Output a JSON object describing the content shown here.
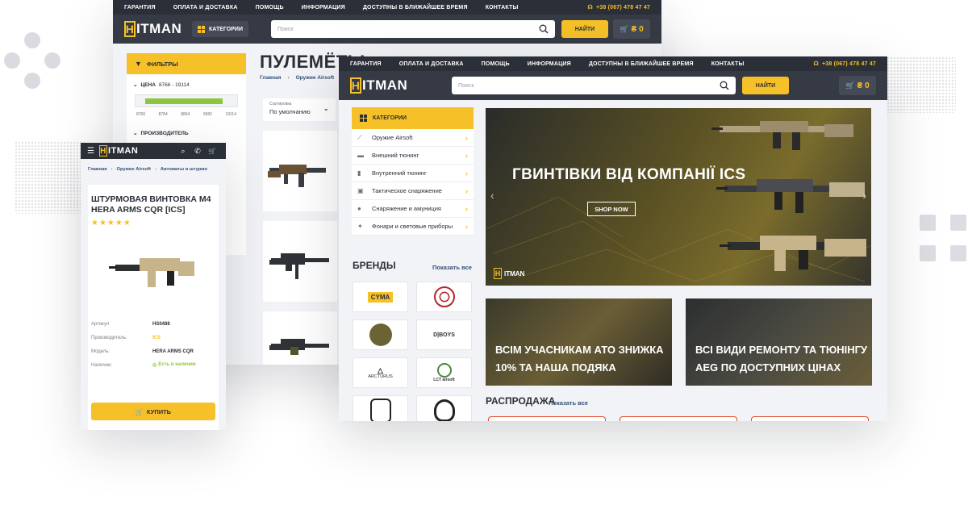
{
  "colors": {
    "accent": "#f5c028",
    "dark": "#2b2f38",
    "green": "#8cc63f",
    "sale": "#e04b2a"
  },
  "back": {
    "top_links": [
      "Гарантия",
      "Оплата и доставка",
      "Помощь",
      "Информация",
      "Доступны в ближайшее время",
      "Контакты"
    ],
    "phone": "+38 (067) 478 47 47",
    "logo_letter": "H",
    "logo_rest": "ITMAN",
    "categories_label": "Категории",
    "search_placeholder": "Поиск",
    "search_button": "Найти",
    "cart_symbol": "₴",
    "cart_count": "0",
    "filters_label": "Фильтры",
    "price_label": "Цена",
    "price_range": "8766 - 19114",
    "price_ticks": [
      "8766",
      "8784",
      "8864",
      "9582",
      "19114"
    ],
    "manufacturer_label": "Производитель",
    "page_title": "Пулемёты",
    "breadcrumb": [
      "Главная",
      "Оружие Airsoft"
    ],
    "sort_label": "Сортировка",
    "sort_value": "По умолчанию"
  },
  "front": {
    "top_links": [
      "Гарантия",
      "Оплата и доставка",
      "Помощь",
      "Информация",
      "Доступны в ближайшее время",
      "Контакты"
    ],
    "phone": "+38 (067) 478 47 47",
    "logo_letter": "H",
    "logo_rest": "ITMAN",
    "search_placeholder": "Поиск",
    "search_button": "Найти",
    "cart_symbol": "₴",
    "cart_count": "0",
    "categories_label": "Категории",
    "categories": [
      {
        "label": "Оружие Airsoft",
        "icon": "rifle-icon"
      },
      {
        "label": "Внешний тюнинг",
        "icon": "scope-icon"
      },
      {
        "label": "Внутренний тюнинг",
        "icon": "magazine-icon"
      },
      {
        "label": "Тактическое снаряжение",
        "icon": "vest-icon"
      },
      {
        "label": "Снаряжение и амуниция",
        "icon": "helmet-icon"
      },
      {
        "label": "Фонари и световые приборы",
        "icon": "flashlight-icon"
      }
    ],
    "brands_label": "Бренды",
    "brands_show_all": "Показать все",
    "brands": [
      "CYMA",
      "",
      "",
      "D|BOYS",
      "ARCTURUS",
      "LCT airsoft",
      "",
      ""
    ],
    "hero_title": "Гвинтівки від компанії ICS",
    "hero_button": "Shop now",
    "hero_logo": "ITMAN",
    "promo1": [
      "Всім учасникам АТО знижка",
      "10% та наша подяка"
    ],
    "promo2": [
      "Всі види ремонту та тюнінгу",
      "AEG по доступних цінах"
    ],
    "sale_label": "Распродажа",
    "sale_show_all": "Показать все"
  },
  "mobile": {
    "logo_letter": "H",
    "logo_rest": "ITMAN",
    "breadcrumb": [
      "Главная",
      "Оружие Airsoft",
      "Автоматы и штурмо"
    ],
    "title": "Штурмовая винтовка M4 HERA ARMS CQR [ICS]",
    "rating": 5,
    "specs": [
      {
        "label": "Артикул",
        "value": "HS0488"
      },
      {
        "label": "Производитель:",
        "value": "ICS"
      },
      {
        "label": "Модель:",
        "value": "HERA ARMS CQR"
      },
      {
        "label": "Наличие:",
        "value": "Есть в наличии"
      }
    ],
    "buy_button": "Купить"
  }
}
